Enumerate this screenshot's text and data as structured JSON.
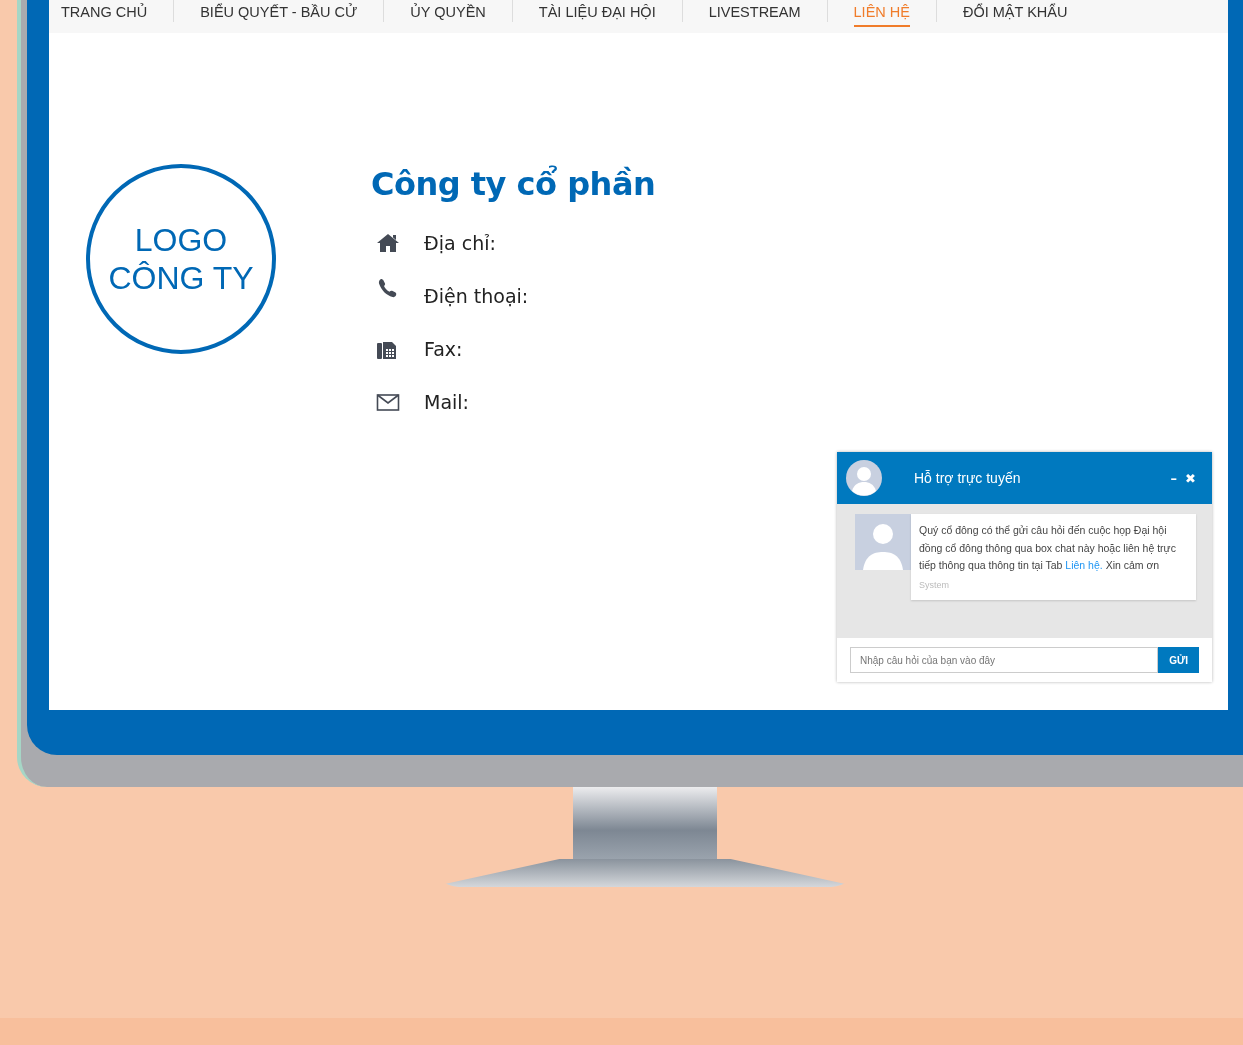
{
  "nav": [
    {
      "label": "TRANG CHỦ",
      "selected": false
    },
    {
      "label": "BIỂU QUYẾT - BẦU CỬ",
      "selected": false
    },
    {
      "label": "ỦY QUYỀN",
      "selected": false
    },
    {
      "label": "TÀI LIỆU ĐẠI HỘI",
      "selected": false
    },
    {
      "label": "LIVESTREAM",
      "selected": false
    },
    {
      "label": "LIÊN HỆ",
      "selected": true
    },
    {
      "label": "ĐỔI MẬT KHẨU",
      "selected": false
    }
  ],
  "logo": {
    "lines": [
      "LOGO",
      "CÔNG TY"
    ]
  },
  "company": {
    "title": "Công ty cổ phần",
    "contacts": [
      {
        "kind": "home",
        "label": "Địa chỉ:"
      },
      {
        "kind": "phone",
        "label": "Điện thoại:"
      },
      {
        "kind": "fax",
        "label": "Fax:"
      },
      {
        "kind": "mail",
        "label": "Mail:"
      }
    ]
  },
  "chat": {
    "title": "Hỗ trợ trực tuyến",
    "minimize": "–",
    "close": "✖",
    "messages": [
      {
        "text_before": "Quý cổ đông có thể gửi câu hỏi đến cuộc họp Đại hội đồng cổ đông thông qua box chat này hoặc liên hệ trực tiếp thông qua thông tin tại Tab ",
        "link": "Liên hệ.",
        "text_after": " Xin cảm ơn",
        "sender": "System"
      }
    ],
    "input": {
      "placeholder": "Nhập câu hỏi của bạn vào đây"
    },
    "send_button": "GỬI"
  }
}
